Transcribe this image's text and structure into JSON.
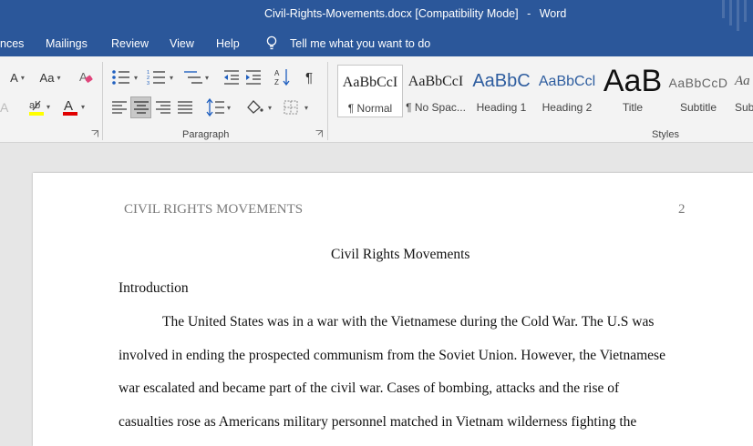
{
  "window": {
    "doc_name": "Civil-Rights-Movements.docx",
    "mode": "[Compatibility Mode]",
    "separator": "-",
    "app_name": "Word",
    "titlebar_color": "#2b579a"
  },
  "menu": {
    "items": [
      "nces",
      "Mailings",
      "Review",
      "View",
      "Help"
    ],
    "tell_me": "Tell me what you want to do"
  },
  "ribbon": {
    "font_group": {
      "grow_font_label": "A",
      "change_case_label": "Aa",
      "font_color_label": "A",
      "highlight_color": "#ffff00",
      "font_color": "#e00000"
    },
    "paragraph_group": {
      "label": "Paragraph",
      "pilcrow": "¶"
    },
    "styles_group": {
      "label": "Styles",
      "styles": [
        {
          "preview": "AaBbCcI",
          "label": "¶ Normal"
        },
        {
          "preview": "AaBbCcI",
          "label": "¶ No Spac..."
        },
        {
          "preview": "AaBbC",
          "label": "Heading 1"
        },
        {
          "preview": "AaBbCcl",
          "label": "Heading 2"
        },
        {
          "preview": "AaB",
          "label": "Title"
        },
        {
          "preview": "AaBbCcD",
          "label": "Subtitle"
        },
        {
          "preview": "Aa",
          "label": "Sub"
        }
      ]
    }
  },
  "document": {
    "running_head": "CIVIL RIGHTS MOVEMENTS",
    "page_number": "2",
    "title": "Civil Rights Movements",
    "heading": "Introduction",
    "body_lines": [
      "The United States was in a war with the Vietnamese during the Cold War. The U.S was",
      "involved in ending the prospected communism from the Soviet Union. However, the Vietnamese",
      "war escalated and became part of the civil war. Cases of bombing, attacks and the rise of",
      "casualties rose as Americans military personnel matched in Vietnam wilderness fighting the"
    ]
  }
}
